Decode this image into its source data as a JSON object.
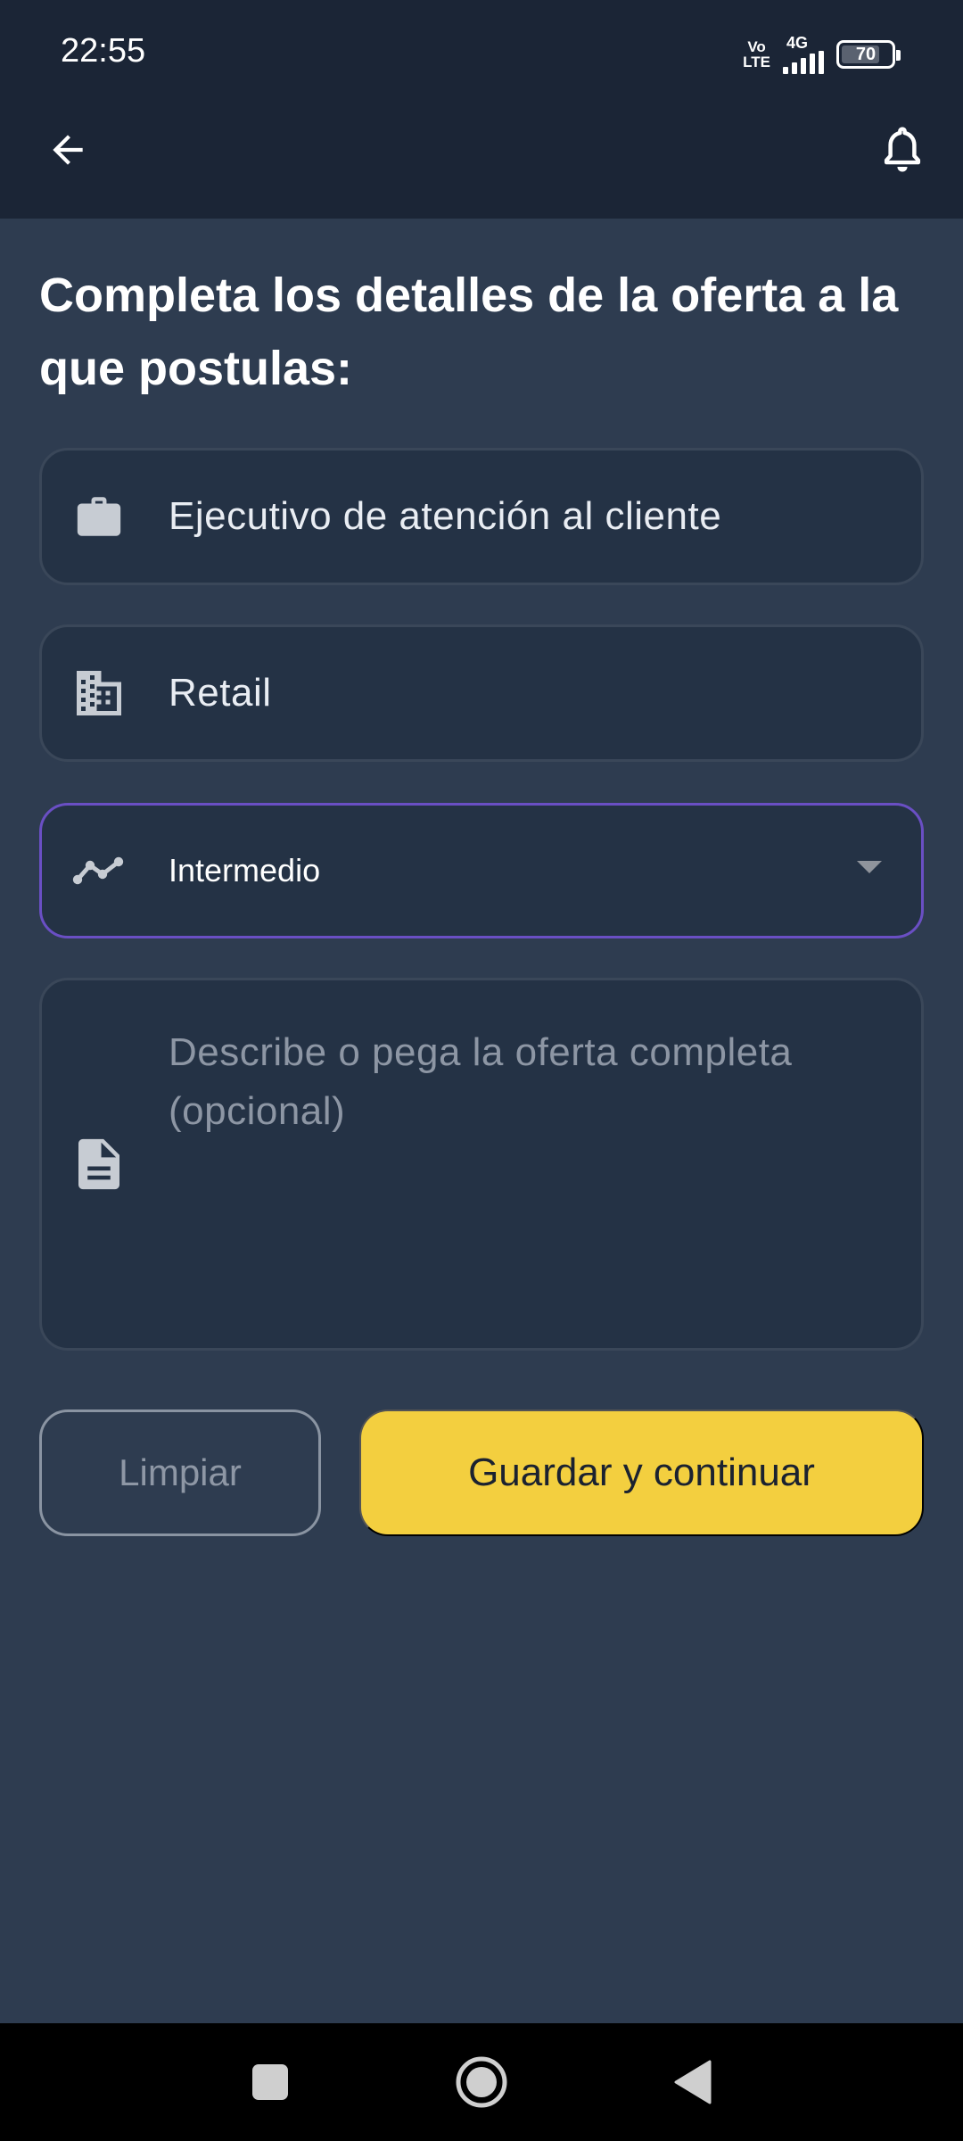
{
  "status_bar": {
    "time": "22:55",
    "volte_top": "Vo",
    "volte_bottom": "LTE",
    "network": "4G",
    "battery": "70"
  },
  "header": {
    "back_icon": "arrow-left-icon",
    "bell_icon": "bell-icon"
  },
  "page": {
    "title": "Completa los detalles de la oferta a la que postulas:"
  },
  "form": {
    "job_title": {
      "icon": "briefcase-icon",
      "value": "Ejecutivo de atención al cliente"
    },
    "industry": {
      "icon": "building-icon",
      "value": "Retail"
    },
    "level": {
      "icon": "trending-icon",
      "value": "Intermedio"
    },
    "description": {
      "icon": "document-icon",
      "value": "",
      "placeholder": "Describe o pega la oferta completa (opcional)"
    }
  },
  "actions": {
    "clear_label": "Limpiar",
    "save_label": "Guardar y continuar"
  },
  "colors": {
    "background": "#2e3c50",
    "header": "#1b2536",
    "field": "#243245",
    "accent_focus": "#6a4fc4",
    "primary_button": "#f3cf3f"
  }
}
